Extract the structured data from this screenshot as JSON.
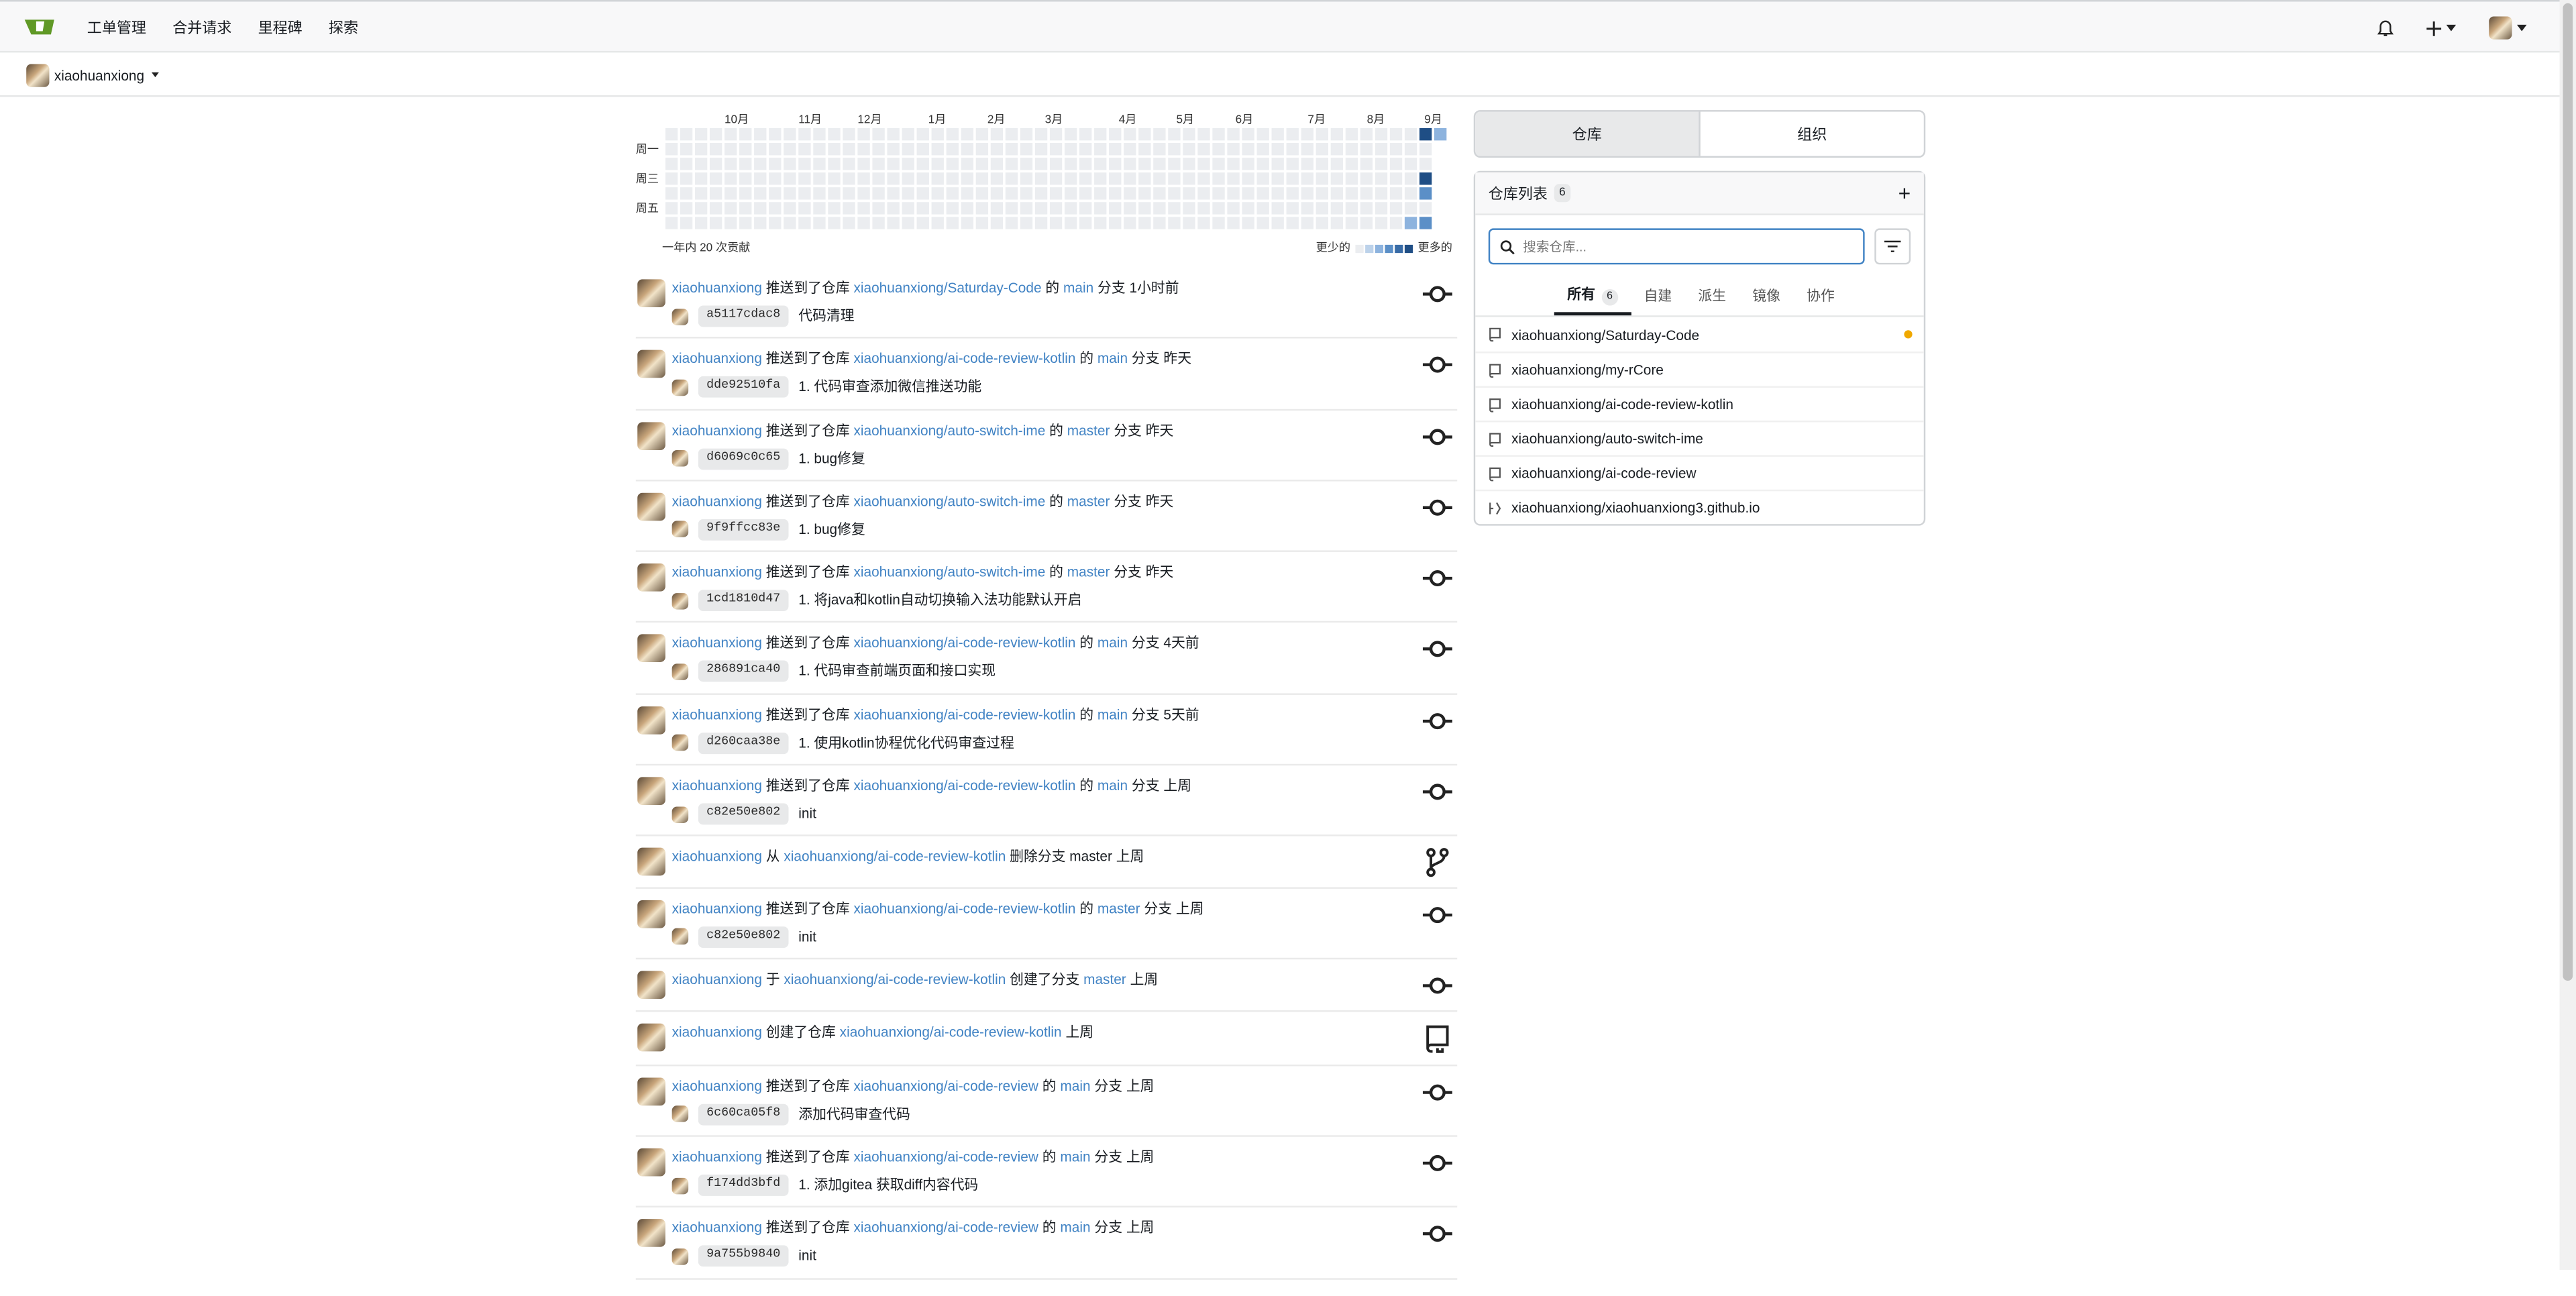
{
  "nav": {
    "items": [
      "工单管理",
      "合并请求",
      "里程碑",
      "探索"
    ]
  },
  "context": {
    "user": "xiaohuanxiong"
  },
  "heatmap": {
    "months": [
      "10月",
      "11月",
      "12月",
      "1月",
      "2月",
      "3月",
      "4月",
      "5月",
      "6月",
      "7月",
      "8月",
      "9月"
    ],
    "weekdays": [
      "周一",
      "周三",
      "周五"
    ],
    "summary": "一年内 20 次贡献",
    "legend_less": "更少的",
    "legend_more": "更多的",
    "colors": [
      "#ebedf0",
      "#bcd2ea",
      "#8db3de",
      "#5b8fc7",
      "#386ba6",
      "#1f4e85"
    ],
    "recent_days": [
      {
        "week": 51,
        "day": 0,
        "level": 5
      },
      {
        "week": 51,
        "day": 3,
        "level": 5
      },
      {
        "week": 51,
        "day": 4,
        "level": 3
      },
      {
        "week": 51,
        "day": 6,
        "level": 3
      },
      {
        "week": 50,
        "day": 6,
        "level": 2
      },
      {
        "week": 52,
        "day": 0,
        "level": 2
      }
    ]
  },
  "feed": [
    {
      "user": "xiaohuanxiong",
      "action": "推送到了仓库",
      "repo": "xiaohuanxiong/Saturday-Code",
      "of": "的",
      "branch": "main",
      "suffix": "分支",
      "time": "1小时前",
      "sha": "a5117cdac8",
      "msg": "代码清理",
      "icon": "commit"
    },
    {
      "user": "xiaohuanxiong",
      "action": "推送到了仓库",
      "repo": "xiaohuanxiong/ai-code-review-kotlin",
      "of": "的",
      "branch": "main",
      "suffix": "分支",
      "time": "昨天",
      "sha": "dde92510fa",
      "msg": "1. 代码审查添加微信推送功能",
      "icon": "commit"
    },
    {
      "user": "xiaohuanxiong",
      "action": "推送到了仓库",
      "repo": "xiaohuanxiong/auto-switch-ime",
      "of": "的",
      "branch": "master",
      "suffix": "分支",
      "time": "昨天",
      "sha": "d6069c0c65",
      "msg": "1. bug修复",
      "icon": "commit"
    },
    {
      "user": "xiaohuanxiong",
      "action": "推送到了仓库",
      "repo": "xiaohuanxiong/auto-switch-ime",
      "of": "的",
      "branch": "master",
      "suffix": "分支",
      "time": "昨天",
      "sha": "9f9ffcc83e",
      "msg": "1. bug修复",
      "icon": "commit"
    },
    {
      "user": "xiaohuanxiong",
      "action": "推送到了仓库",
      "repo": "xiaohuanxiong/auto-switch-ime",
      "of": "的",
      "branch": "master",
      "suffix": "分支",
      "time": "昨天",
      "sha": "1cd1810d47",
      "msg": "1. 将java和kotlin自动切换输入法功能默认开启",
      "icon": "commit"
    },
    {
      "user": "xiaohuanxiong",
      "action": "推送到了仓库",
      "repo": "xiaohuanxiong/ai-code-review-kotlin",
      "of": "的",
      "branch": "main",
      "suffix": "分支",
      "time": "4天前",
      "sha": "286891ca40",
      "msg": "1. 代码审查前端页面和接口实现",
      "icon": "commit"
    },
    {
      "user": "xiaohuanxiong",
      "action": "推送到了仓库",
      "repo": "xiaohuanxiong/ai-code-review-kotlin",
      "of": "的",
      "branch": "main",
      "suffix": "分支",
      "time": "5天前",
      "sha": "d260caa38e",
      "msg": "1. 使用kotlin协程优化代码审查过程",
      "icon": "commit"
    },
    {
      "user": "xiaohuanxiong",
      "action": "推送到了仓库",
      "repo": "xiaohuanxiong/ai-code-review-kotlin",
      "of": "的",
      "branch": "main",
      "suffix": "分支",
      "time": "上周",
      "sha": "c82e50e802",
      "msg": "init",
      "icon": "commit"
    },
    {
      "user": "xiaohuanxiong",
      "action": "从",
      "repo": "xiaohuanxiong/ai-code-review-kotlin",
      "of": "删除分支",
      "branch_plain": "master",
      "time": "上周",
      "icon": "branch"
    },
    {
      "user": "xiaohuanxiong",
      "action": "推送到了仓库",
      "repo": "xiaohuanxiong/ai-code-review-kotlin",
      "of": "的",
      "branch": "master",
      "suffix": "分支",
      "time": "上周",
      "sha": "c82e50e802",
      "msg": "init",
      "icon": "commit"
    },
    {
      "user": "xiaohuanxiong",
      "action": "于",
      "repo": "xiaohuanxiong/ai-code-review-kotlin",
      "of": "创建了分支",
      "branch": "master",
      "time": "上周",
      "icon": "commit"
    },
    {
      "user": "xiaohuanxiong",
      "action": "创建了仓库",
      "repo": "xiaohuanxiong/ai-code-review-kotlin",
      "time": "上周",
      "icon": "repo"
    },
    {
      "user": "xiaohuanxiong",
      "action": "推送到了仓库",
      "repo": "xiaohuanxiong/ai-code-review",
      "of": "的",
      "branch": "main",
      "suffix": "分支",
      "time": "上周",
      "sha": "6c60ca05f8",
      "msg": "添加代码审查代码",
      "icon": "commit"
    },
    {
      "user": "xiaohuanxiong",
      "action": "推送到了仓库",
      "repo": "xiaohuanxiong/ai-code-review",
      "of": "的",
      "branch": "main",
      "suffix": "分支",
      "time": "上周",
      "sha": "f174dd3bfd",
      "msg": "1. 添加gitea 获取diff内容代码",
      "icon": "commit"
    },
    {
      "user": "xiaohuanxiong",
      "action": "推送到了仓库",
      "repo": "xiaohuanxiong/ai-code-review",
      "of": "的",
      "branch": "main",
      "suffix": "分支",
      "time": "上周",
      "sha": "9a755b9840",
      "msg": "init",
      "icon": "commit"
    }
  ],
  "sidebar": {
    "tabs": [
      "仓库",
      "组织"
    ],
    "repo_list_title": "仓库列表",
    "repo_count": "6",
    "search_placeholder": "搜索仓库...",
    "filter_tabs": [
      "所有",
      "自建",
      "派生",
      "镜像",
      "协作"
    ],
    "filter_all_count": "6",
    "repos": [
      {
        "name": "xiaohuanxiong/Saturday-Code",
        "icon": "repo-icon",
        "dot": true
      },
      {
        "name": "xiaohuanxiong/my-rCore",
        "icon": "repo-icon"
      },
      {
        "name": "xiaohuanxiong/ai-code-review-kotlin",
        "icon": "repo-icon"
      },
      {
        "name": "xiaohuanxiong/auto-switch-ime",
        "icon": "repo-icon"
      },
      {
        "name": "xiaohuanxiong/ai-code-review",
        "icon": "repo-icon"
      },
      {
        "name": "xiaohuanxiong/xiaohuanxiong3.github.io",
        "icon": "fork-icon"
      }
    ]
  }
}
